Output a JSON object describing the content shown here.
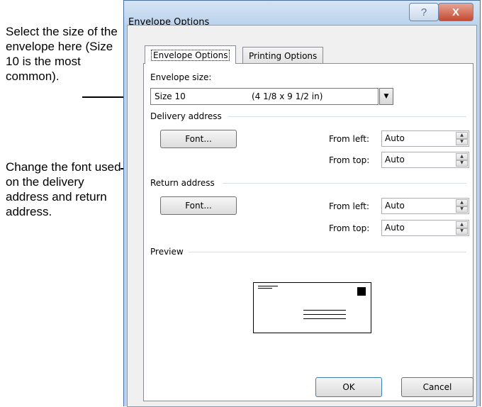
{
  "annotations": {
    "envelope_size_note": "Select the size of the envelope here (Size 10 is the most common).",
    "font_note": "Change the font used on the delivery address and return address."
  },
  "window": {
    "title": "Envelope Options",
    "help_glyph": "?",
    "close_glyph": "X"
  },
  "tabs": [
    {
      "label": "Envelope Options",
      "active": true
    },
    {
      "label": "Printing Options",
      "active": false
    }
  ],
  "envelope_size": {
    "label": "Envelope size:",
    "selected_name": "Size 10",
    "selected_dimensions": "(4 1/8 x 9 1/2 in)",
    "dropdown_glyph": "▼"
  },
  "delivery_address": {
    "group_label": "Delivery address",
    "font_button": "Font...",
    "from_left_label": "From left:",
    "from_left_value": "Auto",
    "from_top_label": "From top:",
    "from_top_value": "Auto"
  },
  "return_address": {
    "group_label": "Return address",
    "font_button": "Font...",
    "from_left_label": "From left:",
    "from_left_value": "Auto",
    "from_top_label": "From top:",
    "from_top_value": "Auto"
  },
  "preview": {
    "group_label": "Preview"
  },
  "buttons": {
    "ok": "OK",
    "cancel": "Cancel"
  },
  "spin_glyphs": {
    "up": "▲",
    "down": "▼"
  }
}
